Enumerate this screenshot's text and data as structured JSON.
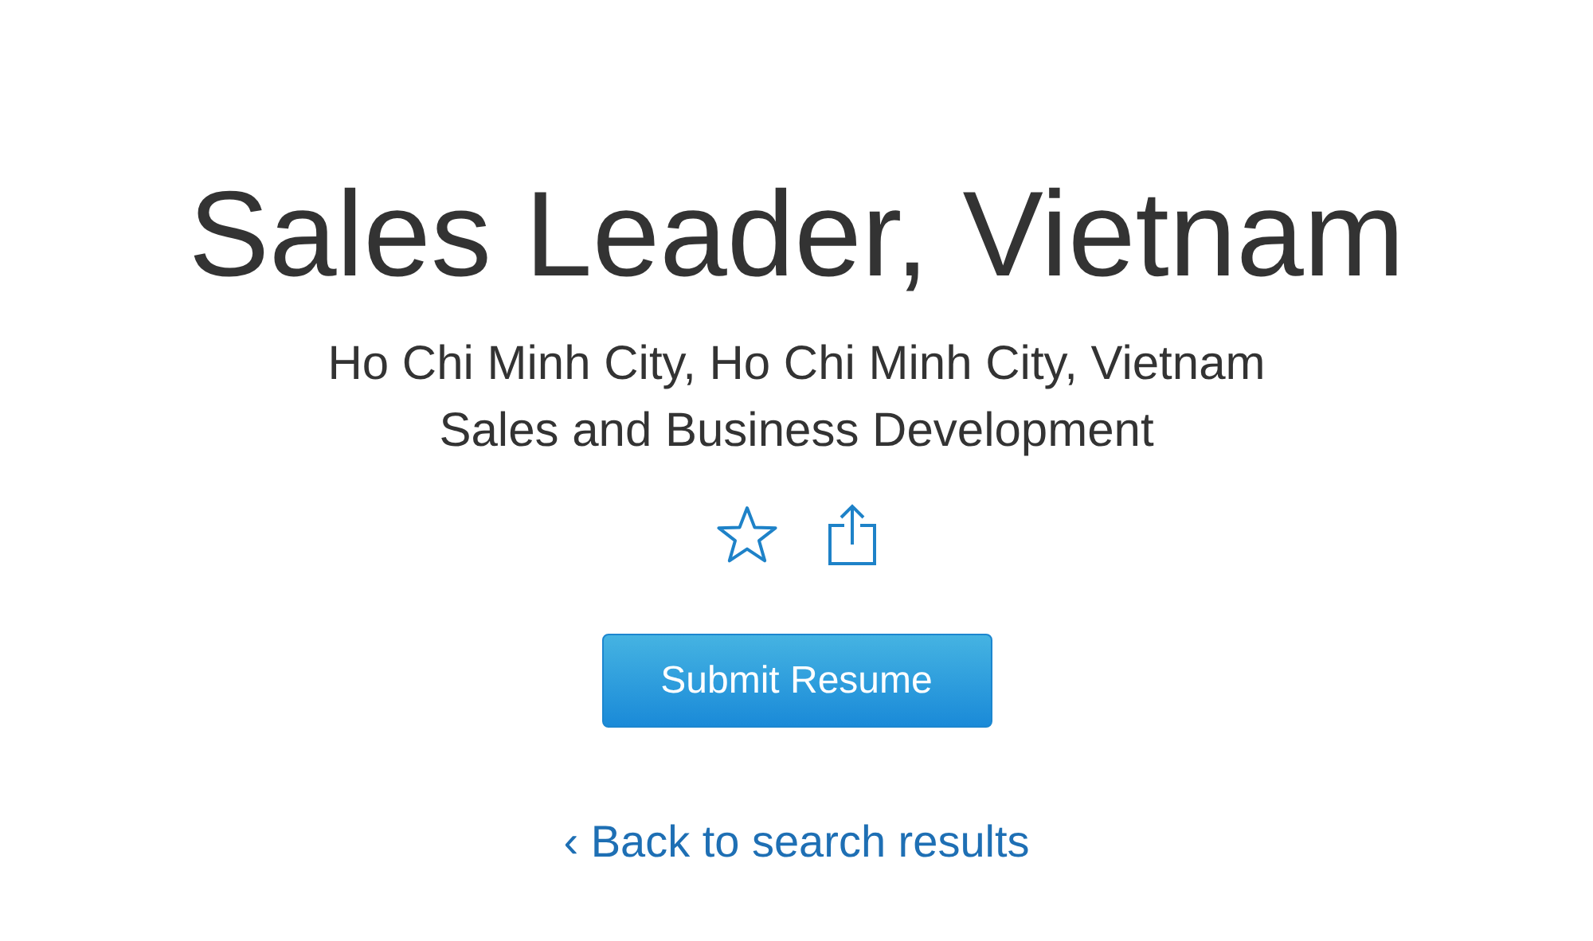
{
  "job": {
    "title": "Sales Leader, Vietnam",
    "location": "Ho Chi Minh City, Ho Chi Minh City, Vietnam",
    "team": "Sales and Business Development"
  },
  "submit_button": "Submit Resume",
  "back_link": "‹ Back to search results"
}
